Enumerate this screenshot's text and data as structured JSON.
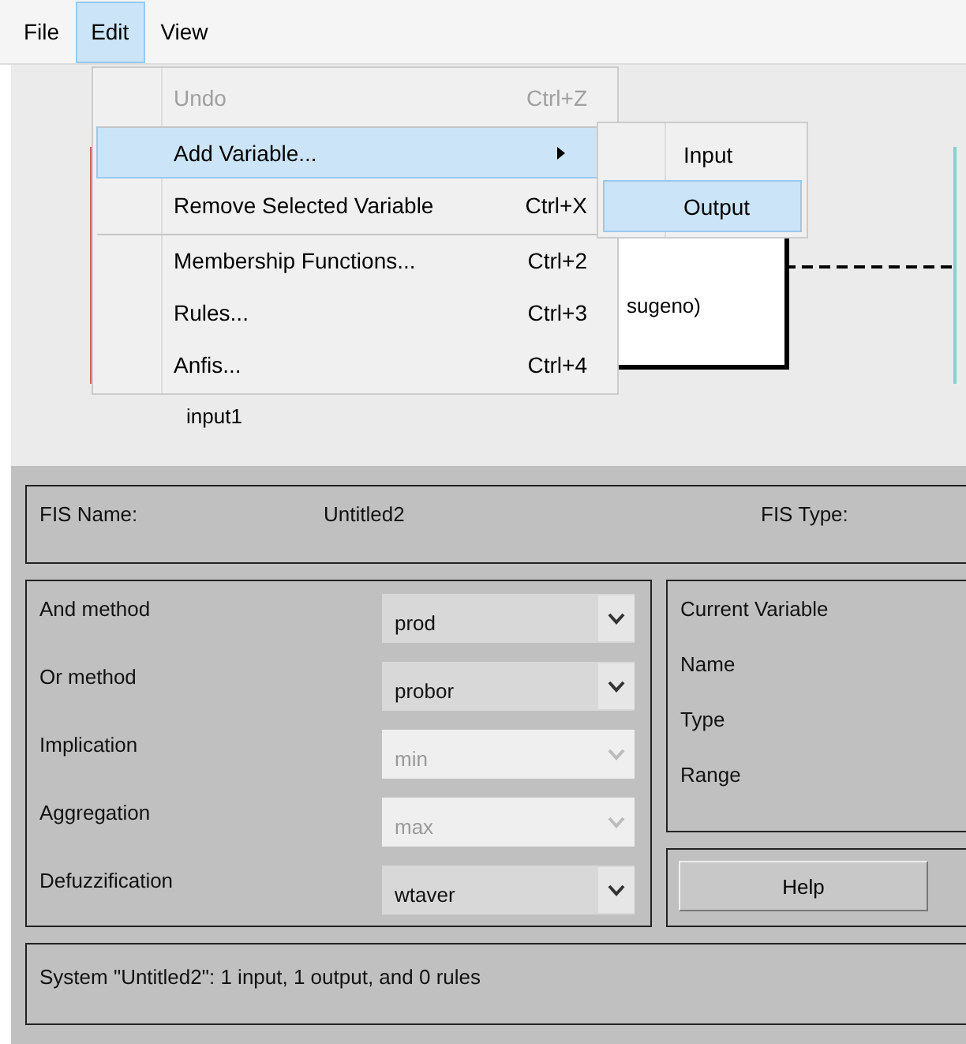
{
  "menubar": [
    {
      "label": "File",
      "selected": false
    },
    {
      "label": "Edit",
      "selected": true
    },
    {
      "label": "View",
      "selected": false
    }
  ],
  "edit_menu": [
    {
      "kind": "item",
      "label": "Undo",
      "shortcut": "Ctrl+Z",
      "disabled": true,
      "selected": false,
      "separator_before": false
    },
    {
      "kind": "submenu",
      "label": "Add Variable...",
      "disabled": false,
      "selected": true,
      "separator_before": true
    },
    {
      "kind": "item",
      "label": "Remove Selected Variable",
      "shortcut": "Ctrl+X",
      "disabled": false,
      "selected": false,
      "separator_before": false
    },
    {
      "kind": "item",
      "label": "Membership Functions...",
      "shortcut": "Ctrl+2",
      "disabled": false,
      "selected": false,
      "separator_before": true
    },
    {
      "kind": "item",
      "label": "Rules...",
      "shortcut": "Ctrl+3",
      "disabled": false,
      "selected": false,
      "separator_before": false
    },
    {
      "kind": "item",
      "label": "Anfis...",
      "shortcut": "Ctrl+4",
      "disabled": false,
      "selected": false,
      "separator_before": false
    }
  ],
  "submenu": [
    {
      "label": "Input",
      "selected": false
    },
    {
      "label": "Output",
      "selected": true
    }
  ],
  "diagram": {
    "system_box_text": "sugeno)",
    "input_label": "input1"
  },
  "fis": {
    "name_label": "FIS Name:",
    "name": "Untitled2",
    "type_label": "FIS Type:"
  },
  "methods": [
    {
      "label": "And method",
      "value": "prod",
      "disabled": false
    },
    {
      "label": "Or method",
      "value": "probor",
      "disabled": false
    },
    {
      "label": "Implication",
      "value": "min",
      "disabled": true
    },
    {
      "label": "Aggregation",
      "value": "max",
      "disabled": true
    },
    {
      "label": "Defuzzification",
      "value": "wtaver",
      "disabled": false
    }
  ],
  "current_variable": {
    "title": "Current Variable",
    "fields": [
      "Name",
      "Type",
      "Range"
    ]
  },
  "help_button": "Help",
  "status": "System \"Untitled2\": 1 input, 1 output, and 0 rules"
}
